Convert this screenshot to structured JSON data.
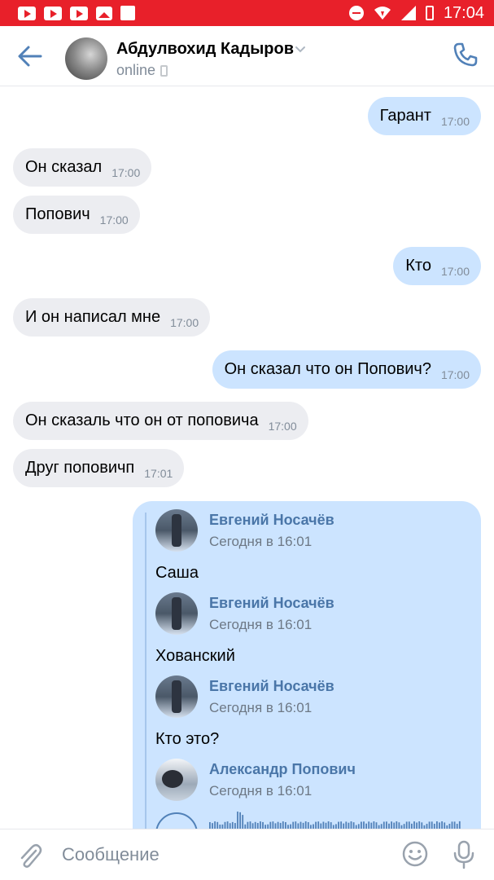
{
  "status_bar": {
    "time": "17:04"
  },
  "header": {
    "contact_name": "Абдулвохид Кадыров",
    "presence": "online"
  },
  "messages": [
    {
      "dir": "out",
      "text": "Гарант",
      "time": "17:00"
    },
    {
      "dir": "in",
      "text": "Он сказал",
      "time": "17:00"
    },
    {
      "dir": "in",
      "text": "Попович",
      "time": "17:00"
    },
    {
      "dir": "out",
      "text": "Кто",
      "time": "17:00"
    },
    {
      "dir": "in",
      "text": "И он написал мне",
      "time": "17:00"
    },
    {
      "dir": "out",
      "text": "Он сказал что он Попович?",
      "time": "17:00"
    },
    {
      "dir": "in",
      "text": "Он сказаль что он от поповича",
      "time": "17:00"
    },
    {
      "dir": "in",
      "text": "Друг поповичп",
      "time": "17:01"
    }
  ],
  "forwarded": [
    {
      "author": "Евгений Носачёв",
      "date": "Сегодня в 16:01",
      "text": "Саша"
    },
    {
      "author": "Евгений Носачёв",
      "date": "Сегодня в 16:01",
      "text": "Хованский"
    },
    {
      "author": "Евгений Носачёв",
      "date": "Сегодня в 16:01",
      "text": "Кто это?"
    },
    {
      "author": "Александр Попович",
      "date": "Сегодня в 16:01",
      "text": ""
    }
  ],
  "composer": {
    "placeholder": "Сообщение"
  },
  "colors": {
    "status_bar": "#e8202a",
    "accent": "#5181b8",
    "bubble_out": "#cce4ff",
    "bubble_in": "#ecedf1",
    "forward_author": "#4a76a8"
  }
}
